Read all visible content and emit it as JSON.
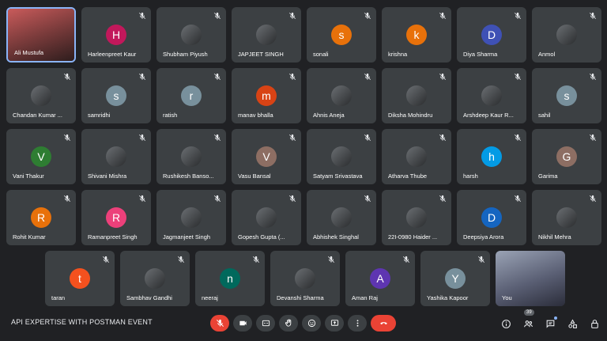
{
  "meeting": {
    "title": "API EXPERTISE WITH POSTMAN EVENT",
    "participant_count": "39"
  },
  "colors": {
    "background": "#202124",
    "tile": "#3c4043",
    "end_call": "#ea4335"
  },
  "participants": [
    {
      "name": "Ali Mustufa",
      "initial": "",
      "color": "",
      "photo": true,
      "video": true
    },
    {
      "name": "Harleenpreet Kaur",
      "initial": "H",
      "color": "#c2185b"
    },
    {
      "name": "Shubham Piyush",
      "initial": "",
      "color": "",
      "photo": true
    },
    {
      "name": "JAPJEET SINGH",
      "initial": "",
      "color": "",
      "photo": true
    },
    {
      "name": "sonali",
      "initial": "s",
      "color": "#e8710a"
    },
    {
      "name": "krishna",
      "initial": "k",
      "color": "#e8710a"
    },
    {
      "name": "Diya Sharma",
      "initial": "D",
      "color": "#3f51b5"
    },
    {
      "name": "Anmol",
      "initial": "",
      "color": "",
      "photo": true
    },
    {
      "name": "Chandan Kumar ...",
      "initial": "",
      "color": "",
      "photo": true
    },
    {
      "name": "samridhi",
      "initial": "s",
      "color": "#78909c"
    },
    {
      "name": "ratish",
      "initial": "r",
      "color": "#78909c"
    },
    {
      "name": "manav bhalla",
      "initial": "m",
      "color": "#d84315"
    },
    {
      "name": "Ahnis Aneja",
      "initial": "",
      "color": "",
      "photo": true
    },
    {
      "name": "Diksha Mohindru",
      "initial": "",
      "color": "",
      "photo": true
    },
    {
      "name": "Arshdeep Kaur R...",
      "initial": "",
      "color": "",
      "photo": true
    },
    {
      "name": "sahil",
      "initial": "s",
      "color": "#78909c"
    },
    {
      "name": "Vani Thakur",
      "initial": "V",
      "color": "#2e7d32"
    },
    {
      "name": "Shivani Mishra",
      "initial": "",
      "color": "",
      "photo": true
    },
    {
      "name": "Rushikesh Banso...",
      "initial": "",
      "color": "",
      "photo": true
    },
    {
      "name": "Vasu Bansal",
      "initial": "V",
      "color": "#8d6e63"
    },
    {
      "name": "Satyam Srivastava",
      "initial": "",
      "color": "",
      "photo": true
    },
    {
      "name": "Atharva Thube",
      "initial": "",
      "color": "",
      "photo": true
    },
    {
      "name": "harsh",
      "initial": "h",
      "color": "#039be5"
    },
    {
      "name": "Garima",
      "initial": "G",
      "color": "#8d6e63"
    },
    {
      "name": "Rohit Kumar",
      "initial": "R",
      "color": "#e8710a"
    },
    {
      "name": "Ramanpreet Singh",
      "initial": "R",
      "color": "#ec407a"
    },
    {
      "name": "Jagmanjeet Singh",
      "initial": "",
      "color": "",
      "photo": true
    },
    {
      "name": "Gopesh Gupta (...",
      "initial": "",
      "color": "",
      "photo": true
    },
    {
      "name": "Abhishek Singhal",
      "initial": "",
      "color": "",
      "photo": true
    },
    {
      "name": "22I-0980 Haider ...",
      "initial": "",
      "color": "",
      "photo": true
    },
    {
      "name": "Deepsiya Arora",
      "initial": "D",
      "color": "#1565c0"
    },
    {
      "name": "Nikhil Mehra",
      "initial": "",
      "color": "",
      "photo": true
    },
    {
      "name": "taran",
      "initial": "t",
      "color": "#f4511e"
    },
    {
      "name": "Sambhav Gandhi",
      "initial": "",
      "color": "",
      "photo": true
    },
    {
      "name": "neeraj",
      "initial": "n",
      "color": "#00695c"
    },
    {
      "name": "Devanshi Sharma",
      "initial": "",
      "color": "",
      "photo": true
    },
    {
      "name": "Aman Raj",
      "initial": "A",
      "color": "#5e35b1"
    },
    {
      "name": "Yashika Kapoor",
      "initial": "Y",
      "color": "#78909c"
    },
    {
      "name": "You",
      "initial": "",
      "color": "",
      "photo": true,
      "video": true
    }
  ],
  "controls": [
    "mic-off",
    "camera",
    "captions",
    "raise-hand",
    "emoji",
    "present",
    "more",
    "end-call"
  ],
  "right_icons": [
    "info",
    "people",
    "chat",
    "activities",
    "host-controls"
  ]
}
